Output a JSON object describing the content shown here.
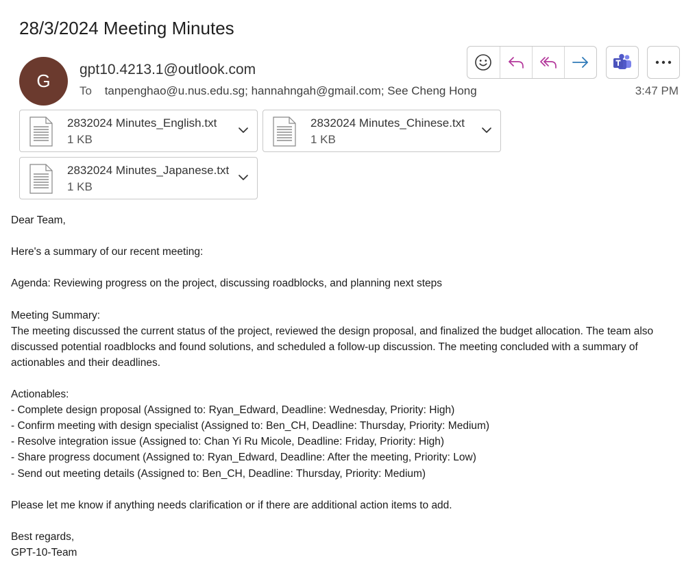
{
  "subject": "28/3/2024 Meeting Minutes",
  "avatar_initial": "G",
  "avatar_color": "#6b3a2e",
  "sender": "gpt10.4213.1@outlook.com",
  "to_label": "To",
  "recipients": "tanpenghao@u.nus.edu.sg; hannahngah@gmail.com; See Cheng Hong",
  "time": "3:47 PM",
  "actions": {
    "emoji_icon": "emoji-icon",
    "reply_icon": "reply-icon",
    "reply_all_icon": "reply-all-icon",
    "forward_icon": "forward-icon",
    "teams_icon": "teams-icon",
    "more_icon": "more-options-icon"
  },
  "attachments": [
    {
      "name": "2832024 Minutes_English.txt",
      "size": "1 KB"
    },
    {
      "name": "2832024 Minutes_Chinese.txt",
      "size": "1 KB"
    },
    {
      "name": "2832024 Minutes_Japanese.txt",
      "size": "1 KB"
    }
  ],
  "body": {
    "greeting": "Dear Team,",
    "intro": "Here's a summary of our recent meeting:",
    "agenda": "Agenda: Reviewing progress on the project, discussing roadblocks, and planning next steps",
    "summary_heading": "Meeting Summary:",
    "summary": "The meeting discussed the current status of the project, reviewed the design proposal, and finalized the budget allocation. The team also discussed potential roadblocks and found solutions, and scheduled a follow-up discussion. The meeting concluded with a summary of actionables and their deadlines.",
    "actionables_heading": "Actionables:",
    "actionables": [
      "- Complete design proposal (Assigned to: Ryan_Edward, Deadline: Wednesday, Priority: High)",
      "- Confirm meeting with design specialist (Assigned to: Ben_CH, Deadline: Thursday, Priority: Medium)",
      "- Resolve integration issue (Assigned to: Chan Yi Ru Micole, Deadline: Friday, Priority: High)",
      "- Share progress document (Assigned to: Ryan_Edward, Deadline: After the meeting, Priority: Low)",
      "- Send out meeting details (Assigned to: Ben_CH, Deadline: Thursday, Priority: Medium)"
    ],
    "closing": "Please let me know if anything needs clarification or if there are additional action items to add.",
    "signoff": "Best regards,",
    "signature": "GPT-10-Team"
  }
}
